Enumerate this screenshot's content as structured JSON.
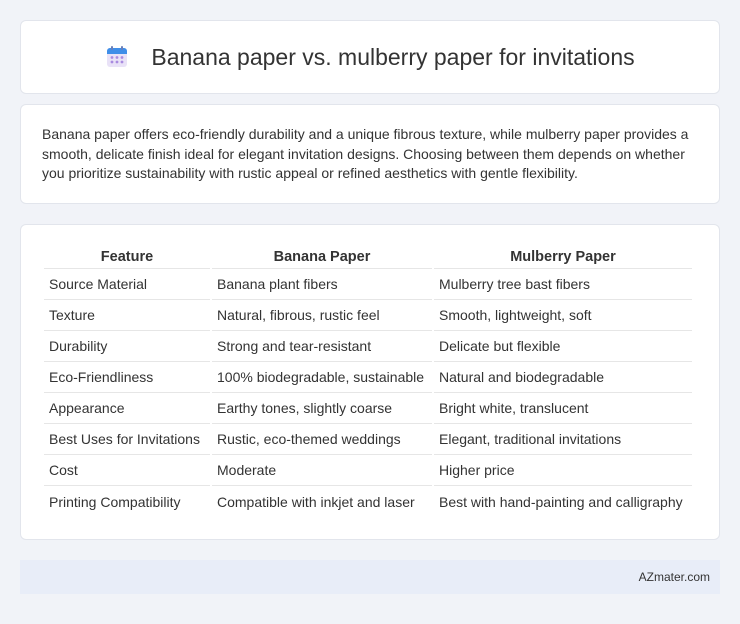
{
  "header": {
    "title": "Banana paper vs. mulberry paper for invitations",
    "icon": "calendar-icon"
  },
  "summary": {
    "text": "Banana paper offers eco-friendly durability and a unique fibrous texture, while mulberry paper provides a smooth, delicate finish ideal for elegant invitation designs. Choosing between them depends on whether you prioritize sustainability with rustic appeal or refined aesthetics with gentle flexibility."
  },
  "table": {
    "headers": [
      "Feature",
      "Banana Paper",
      "Mulberry Paper"
    ],
    "rows": [
      [
        "Source Material",
        "Banana plant fibers",
        "Mulberry tree bast fibers"
      ],
      [
        "Texture",
        "Natural, fibrous, rustic feel",
        "Smooth, lightweight, soft"
      ],
      [
        "Durability",
        "Strong and tear-resistant",
        "Delicate but flexible"
      ],
      [
        "Eco-Friendliness",
        "100% biodegradable, sustainable",
        "Natural and biodegradable"
      ],
      [
        "Appearance",
        "Earthy tones, slightly coarse",
        "Bright white, translucent"
      ],
      [
        "Best Uses for Invitations",
        "Rustic, eco-themed weddings",
        "Elegant, traditional invitations"
      ],
      [
        "Cost",
        "Moderate",
        "Higher price"
      ],
      [
        "Printing Compatibility",
        "Compatible with inkjet and laser",
        "Best with hand-painting and calligraphy"
      ]
    ]
  },
  "footer": {
    "brand": "AZmater.com"
  }
}
